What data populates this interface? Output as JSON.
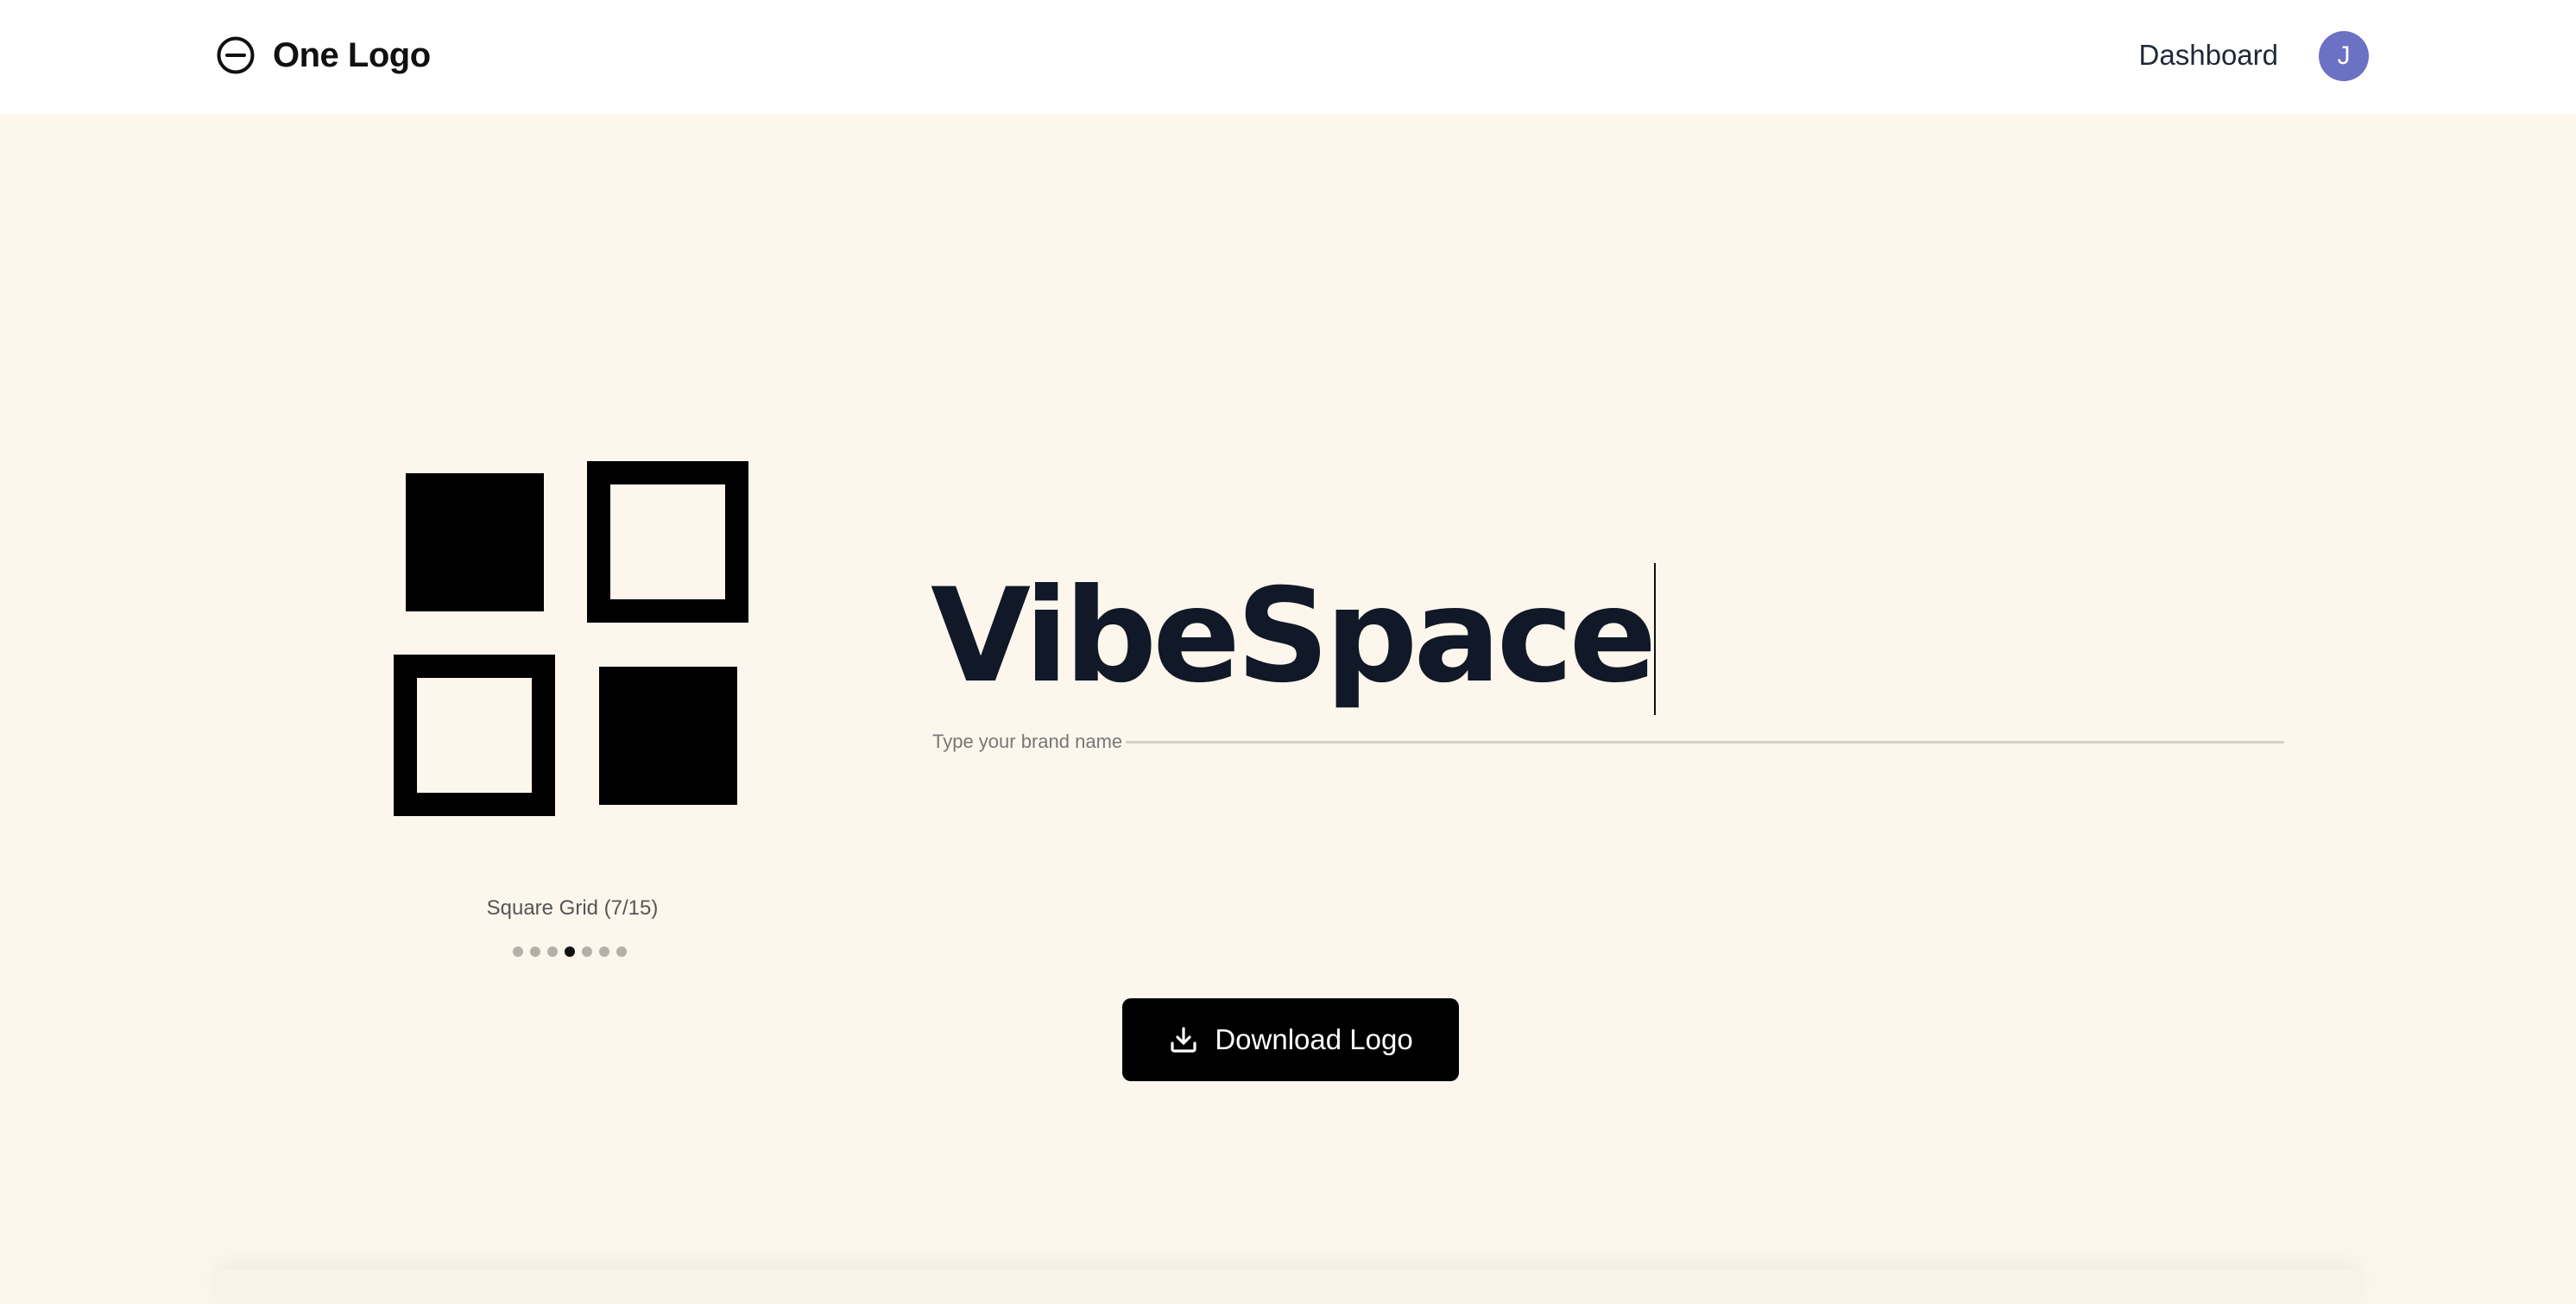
{
  "header": {
    "brand_name": "One Logo",
    "brand_icon": "minus-circle-icon",
    "dashboard_label": "Dashboard",
    "avatar_initial": "J"
  },
  "logo_preview": {
    "style_name": "Square Grid (7/15)",
    "current_index": 7,
    "total": 15,
    "dots_visible": 7,
    "active_dot": 4
  },
  "brand_input": {
    "value": "VibeSpace",
    "label": "Type your brand name"
  },
  "actions": {
    "download_label": "Download Logo",
    "download_icon": "download-icon"
  },
  "colors": {
    "page_background": "#fcf6ec",
    "header_background": "#ffffff",
    "avatar_background": "#6c71c4",
    "button_background": "#000000",
    "brand_text": "#111827"
  }
}
